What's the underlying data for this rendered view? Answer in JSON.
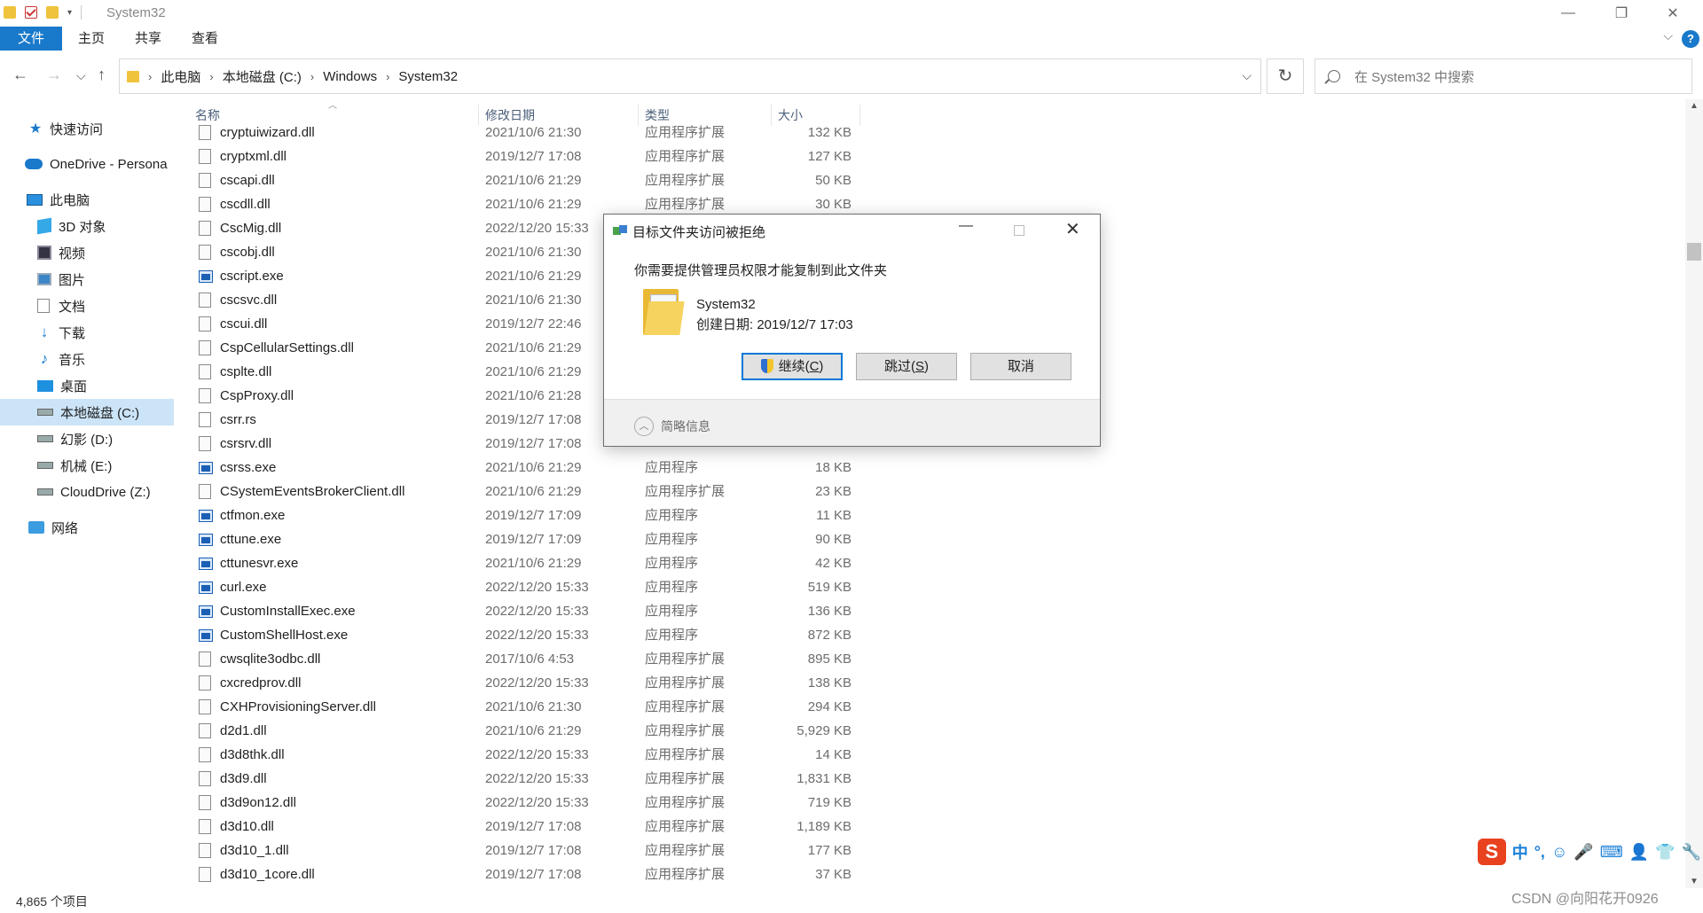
{
  "window": {
    "title": "System32",
    "minimize": "—",
    "restore": "❐",
    "close": "✕"
  },
  "ribbon": {
    "tabs": [
      "文件",
      "主页",
      "共享",
      "查看"
    ],
    "help": "?",
    "collapse": "⌵"
  },
  "nav": {
    "back": "←",
    "forward": "→",
    "recent": "⌵",
    "up": "↑"
  },
  "address": {
    "crumbs": [
      "此电脑",
      "本地磁盘 (C:)",
      "Windows",
      "System32"
    ],
    "separator": "›",
    "dropdown": "⌵",
    "refresh": "↻"
  },
  "search": {
    "placeholder": "在 System32 中搜索"
  },
  "sidebar": {
    "items": [
      {
        "label": "快速访问",
        "icon": "star-icon"
      },
      {
        "label": "OneDrive - Persona",
        "icon": "cloud-icon"
      },
      {
        "label": "此电脑",
        "icon": "computer-icon"
      },
      {
        "label": "3D 对象",
        "icon": "cube-icon"
      },
      {
        "label": "视频",
        "icon": "video-icon"
      },
      {
        "label": "图片",
        "icon": "picture-icon"
      },
      {
        "label": "文档",
        "icon": "document-icon"
      },
      {
        "label": "下载",
        "icon": "download-icon"
      },
      {
        "label": "音乐",
        "icon": "music-icon"
      },
      {
        "label": "桌面",
        "icon": "desktop-icon"
      },
      {
        "label": "本地磁盘 (C:)",
        "icon": "drive-icon",
        "selected": true
      },
      {
        "label": "幻影 (D:)",
        "icon": "drive-icon"
      },
      {
        "label": "机械 (E:)",
        "icon": "drive-icon"
      },
      {
        "label": "CloudDrive (Z:)",
        "icon": "drive-icon"
      },
      {
        "label": "网络",
        "icon": "network-icon"
      }
    ]
  },
  "columns": {
    "name": "名称",
    "date": "修改日期",
    "type": "类型",
    "size": "大小"
  },
  "files": [
    {
      "name": "cryptuiwizard.dll",
      "date": "2021/10/6 21:30",
      "type": "应用程序扩展",
      "size": "132 KB",
      "kind": "dll"
    },
    {
      "name": "cryptxml.dll",
      "date": "2019/12/7 17:08",
      "type": "应用程序扩展",
      "size": "127 KB",
      "kind": "dll"
    },
    {
      "name": "cscapi.dll",
      "date": "2021/10/6 21:29",
      "type": "应用程序扩展",
      "size": "50 KB",
      "kind": "dll"
    },
    {
      "name": "cscdll.dll",
      "date": "2021/10/6 21:29",
      "type": "应用程序扩展",
      "size": "30 KB",
      "kind": "dll"
    },
    {
      "name": "CscMig.dll",
      "date": "2022/12/20 15:33",
      "type": "",
      "size": "",
      "kind": "dll"
    },
    {
      "name": "cscobj.dll",
      "date": "2021/10/6 21:30",
      "type": "",
      "size": "",
      "kind": "dll"
    },
    {
      "name": "cscript.exe",
      "date": "2021/10/6 21:29",
      "type": "",
      "size": "",
      "kind": "exe"
    },
    {
      "name": "cscsvc.dll",
      "date": "2021/10/6 21:30",
      "type": "",
      "size": "",
      "kind": "dll"
    },
    {
      "name": "cscui.dll",
      "date": "2019/12/7 22:46",
      "type": "",
      "size": "",
      "kind": "dll"
    },
    {
      "name": "CspCellularSettings.dll",
      "date": "2021/10/6 21:29",
      "type": "",
      "size": "",
      "kind": "dll"
    },
    {
      "name": "csplte.dll",
      "date": "2021/10/6 21:29",
      "type": "",
      "size": "",
      "kind": "dll"
    },
    {
      "name": "CspProxy.dll",
      "date": "2021/10/6 21:28",
      "type": "",
      "size": "",
      "kind": "dll"
    },
    {
      "name": "csrr.rs",
      "date": "2019/12/7 17:08",
      "type": "",
      "size": "",
      "kind": "rs"
    },
    {
      "name": "csrsrv.dll",
      "date": "2019/12/7 17:08",
      "type": "",
      "size": "",
      "kind": "dll"
    },
    {
      "name": "csrss.exe",
      "date": "2021/10/6 21:29",
      "type": "应用程序",
      "size": "18 KB",
      "kind": "exe"
    },
    {
      "name": "CSystemEventsBrokerClient.dll",
      "date": "2021/10/6 21:29",
      "type": "应用程序扩展",
      "size": "23 KB",
      "kind": "dll"
    },
    {
      "name": "ctfmon.exe",
      "date": "2019/12/7 17:09",
      "type": "应用程序",
      "size": "11 KB",
      "kind": "exe"
    },
    {
      "name": "cttune.exe",
      "date": "2019/12/7 17:09",
      "type": "应用程序",
      "size": "90 KB",
      "kind": "exe"
    },
    {
      "name": "cttunesvr.exe",
      "date": "2021/10/6 21:29",
      "type": "应用程序",
      "size": "42 KB",
      "kind": "exe"
    },
    {
      "name": "curl.exe",
      "date": "2022/12/20 15:33",
      "type": "应用程序",
      "size": "519 KB",
      "kind": "exe"
    },
    {
      "name": "CustomInstallExec.exe",
      "date": "2022/12/20 15:33",
      "type": "应用程序",
      "size": "136 KB",
      "kind": "exe"
    },
    {
      "name": "CustomShellHost.exe",
      "date": "2022/12/20 15:33",
      "type": "应用程序",
      "size": "872 KB",
      "kind": "exe"
    },
    {
      "name": "cwsqlite3odbc.dll",
      "date": "2017/10/6 4:53",
      "type": "应用程序扩展",
      "size": "895 KB",
      "kind": "dll"
    },
    {
      "name": "cxcredprov.dll",
      "date": "2022/12/20 15:33",
      "type": "应用程序扩展",
      "size": "138 KB",
      "kind": "dll"
    },
    {
      "name": "CXHProvisioningServer.dll",
      "date": "2021/10/6 21:30",
      "type": "应用程序扩展",
      "size": "294 KB",
      "kind": "dll"
    },
    {
      "name": "d2d1.dll",
      "date": "2021/10/6 21:29",
      "type": "应用程序扩展",
      "size": "5,929 KB",
      "kind": "dll"
    },
    {
      "name": "d3d8thk.dll",
      "date": "2022/12/20 15:33",
      "type": "应用程序扩展",
      "size": "14 KB",
      "kind": "dll"
    },
    {
      "name": "d3d9.dll",
      "date": "2022/12/20 15:33",
      "type": "应用程序扩展",
      "size": "1,831 KB",
      "kind": "dll"
    },
    {
      "name": "d3d9on12.dll",
      "date": "2022/12/20 15:33",
      "type": "应用程序扩展",
      "size": "719 KB",
      "kind": "dll"
    },
    {
      "name": "d3d10.dll",
      "date": "2019/12/7 17:08",
      "type": "应用程序扩展",
      "size": "1,189 KB",
      "kind": "dll"
    },
    {
      "name": "d3d10_1.dll",
      "date": "2019/12/7 17:08",
      "type": "应用程序扩展",
      "size": "177 KB",
      "kind": "dll"
    },
    {
      "name": "d3d10_1core.dll",
      "date": "2019/12/7 17:08",
      "type": "应用程序扩展",
      "size": "37 KB",
      "kind": "dll"
    }
  ],
  "status": {
    "count": "4,865 个项目"
  },
  "dialog": {
    "title": "目标文件夹访问被拒绝",
    "message": "你需要提供管理员权限才能复制到此文件夹",
    "folder_name": "System32",
    "created": "创建日期: 2019/12/7 17:03",
    "continue_label": "继续(",
    "continue_key": "C",
    "skip_label": "跳过(",
    "skip_key": "S",
    "close_paren": ")",
    "cancel_label": "取消",
    "details_label": "简略信息",
    "minimize": "—",
    "close": "✕",
    "expand": "︿"
  },
  "ime": {
    "logo": "S",
    "items": [
      "中",
      "°,",
      "☺",
      "🎤",
      "⌨",
      "👤",
      "👕",
      "🔧"
    ]
  },
  "watermark": "CSDN @向阳花开0926"
}
